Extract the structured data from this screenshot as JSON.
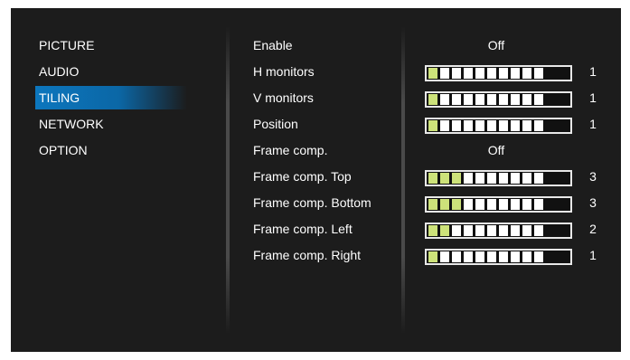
{
  "menu": {
    "items": [
      {
        "label": "PICTURE",
        "selected": false
      },
      {
        "label": "AUDIO",
        "selected": false
      },
      {
        "label": "TILING",
        "selected": true
      },
      {
        "label": "NETWORK",
        "selected": false
      },
      {
        "label": "OPTION",
        "selected": false
      }
    ]
  },
  "settings": [
    {
      "label": "Enable",
      "type": "text",
      "value": "Off"
    },
    {
      "label": "H monitors",
      "type": "slider",
      "level": 1,
      "max": 10,
      "value": "1"
    },
    {
      "label": "V monitors",
      "type": "slider",
      "level": 1,
      "max": 10,
      "value": "1"
    },
    {
      "label": "Position",
      "type": "slider",
      "level": 1,
      "max": 10,
      "value": "1"
    },
    {
      "label": "Frame comp.",
      "type": "text",
      "value": "Off"
    },
    {
      "label": "Frame comp. Top",
      "type": "slider",
      "level": 3,
      "max": 10,
      "value": "3"
    },
    {
      "label": "Frame comp. Bottom",
      "type": "slider",
      "level": 3,
      "max": 10,
      "value": "3"
    },
    {
      "label": "Frame comp. Left",
      "type": "slider",
      "level": 2,
      "max": 10,
      "value": "2"
    },
    {
      "label": "Frame comp. Right",
      "type": "slider",
      "level": 1,
      "max": 10,
      "value": "1"
    }
  ],
  "colors": {
    "background": "#1c1c1c",
    "selection": "#0c76bd",
    "slider_active": "#cde27a",
    "slider_inactive": "#ffffff"
  }
}
